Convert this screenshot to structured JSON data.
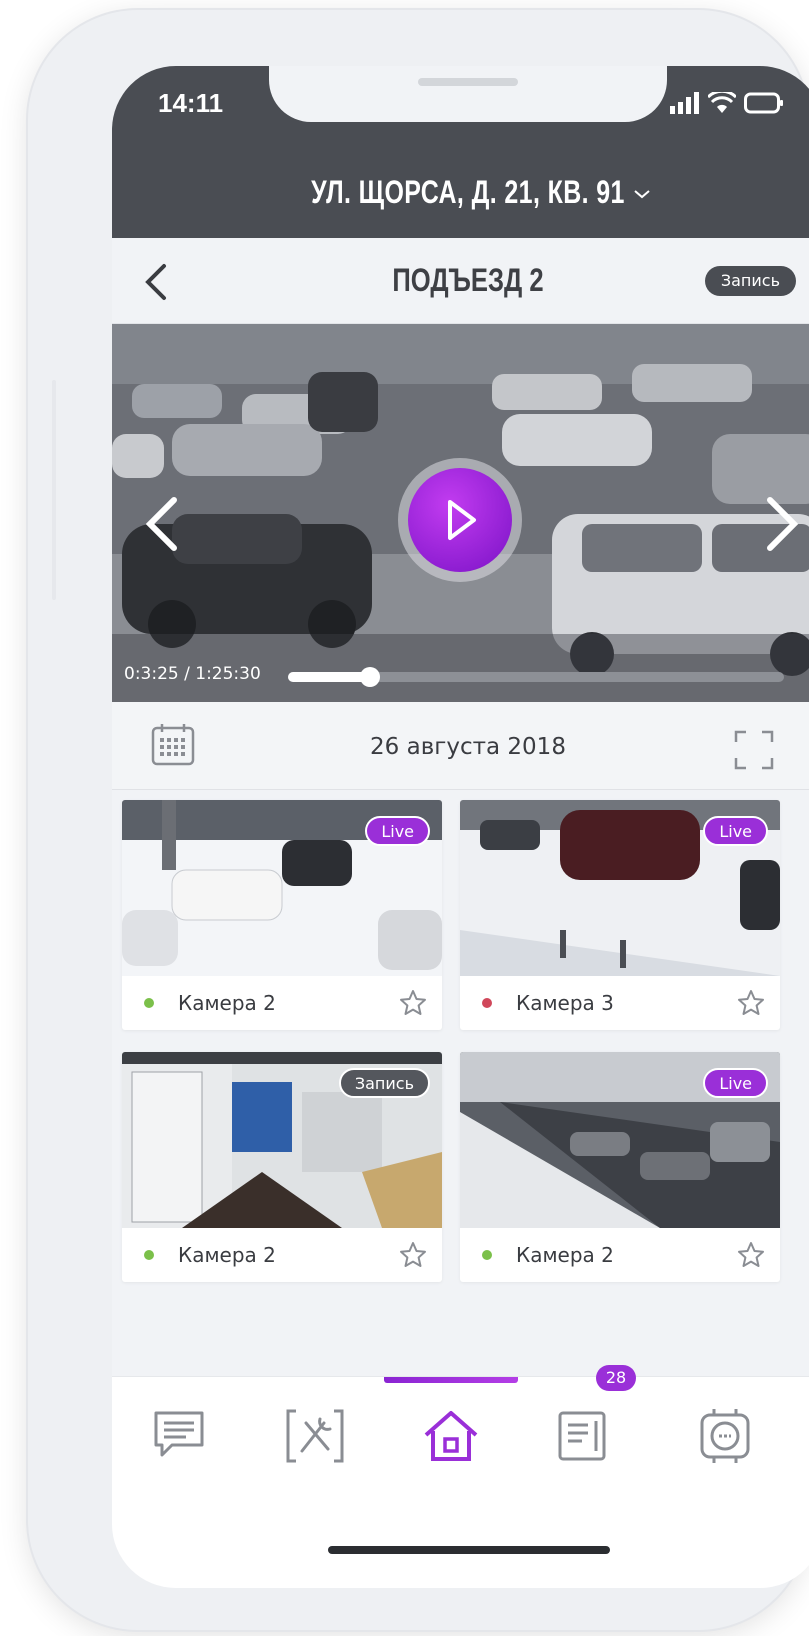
{
  "status_bar": {
    "time": "14:11"
  },
  "header": {
    "address": "УЛ. ЩОРСА, Д. 21, КВ. 91"
  },
  "subheader": {
    "title": "ПОДЪЕЗД 2",
    "record_label": "Запись"
  },
  "player": {
    "time_readout": "0:3:25 / 1:25:30",
    "progress": 0.04
  },
  "datebar": {
    "date": "26 августа 2018"
  },
  "cameras": [
    {
      "label": "Камера 2",
      "badge": "Live",
      "status_color": "#7bc04a",
      "scene": "parking-snow"
    },
    {
      "label": "Камера 3",
      "badge": "Live",
      "status_color": "#d0475a",
      "scene": "car-snow"
    },
    {
      "label": "Камера 2",
      "badge": "Запись",
      "status_color": "#7bc04a",
      "scene": "lobby"
    },
    {
      "label": "Камера 2",
      "badge": "Live",
      "status_color": "#7bc04a",
      "scene": "street-winter"
    }
  ],
  "tabbar": {
    "messages_count": "28",
    "tabs": [
      {
        "icon": "chat-icon"
      },
      {
        "icon": "tools-icon"
      },
      {
        "icon": "home-icon"
      },
      {
        "icon": "news-icon"
      },
      {
        "icon": "intercom-icon"
      }
    ]
  },
  "colors": {
    "accent": "#9a2fd8",
    "header": "#4a4d53",
    "live_badge": "#9a2fd8"
  }
}
